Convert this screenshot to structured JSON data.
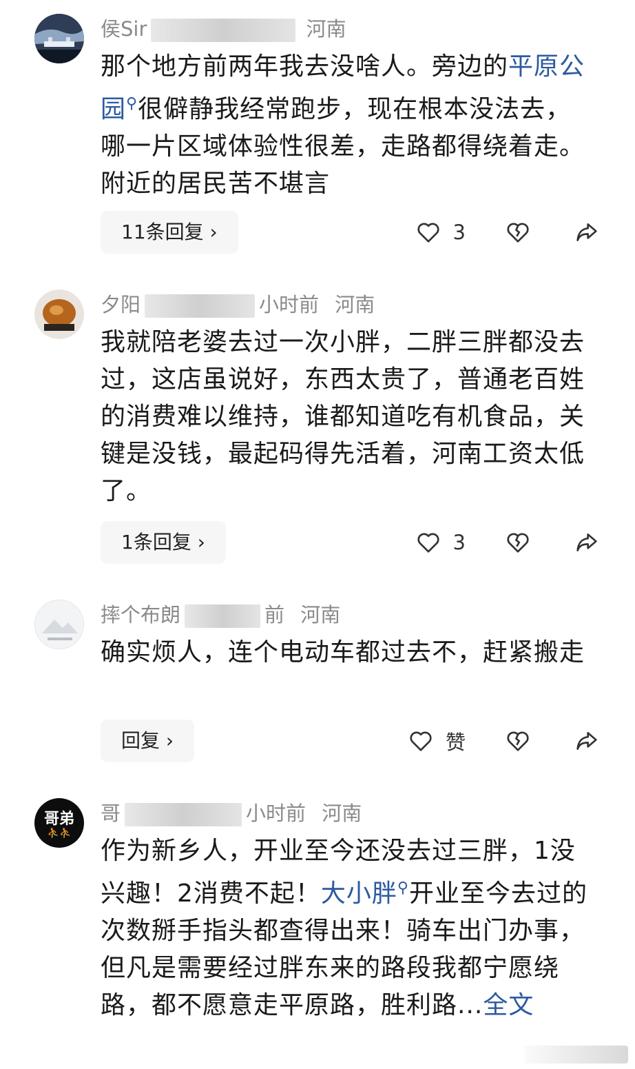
{
  "comments": [
    {
      "author": "侯Sir",
      "time": "",
      "region": "河南",
      "text_parts": [
        {
          "t": "那个地方前两年我去没啥人。旁边的",
          "link": false
        },
        {
          "t": "平原公园",
          "link": true
        },
        {
          "t": "很僻静我经常跑步，现在根本没法去，哪一片区域体验性很差，走路都得绕着走。附近的居民苦不堪言",
          "link": false
        }
      ],
      "reply_label": "11条回复",
      "likes": "3"
    },
    {
      "author": "夕阳",
      "time": "小时前",
      "region": "河南",
      "text_parts": [
        {
          "t": "我就陪老婆去过一次小胖，二胖三胖都没去过，这店虽说好，东西太贵了，普通老百姓的消费难以维持，谁都知道吃有机食品，关键是没钱，最起码得先活着，河南工资太低了。",
          "link": false
        }
      ],
      "reply_label": "1条回复",
      "likes": "3"
    },
    {
      "author": "摔个布朗",
      "time": "前",
      "region": "河南",
      "text_parts": [
        {
          "t": "确实烦人，连个电动车都过去不，赶紧搬走",
          "link": false
        }
      ],
      "reply_label": "回复",
      "likes": "赞"
    },
    {
      "author": "哥",
      "time": "小时前",
      "region": "河南",
      "text_parts": [
        {
          "t": "作为新乡人，开业至今还没去过三胖，1没兴趣！2消费不起！",
          "link": false
        },
        {
          "t": "大小胖",
          "link": true
        },
        {
          "t": "开业至今去过的次数掰手指头都查得出来！骑车出门办事，但凡是需要经过胖东来的路段我都宁愿绕路，都不愿意走平原路，胜利路...",
          "link": false
        },
        {
          "t": "全文",
          "link": true,
          "plain": true
        }
      ]
    }
  ],
  "icons": {
    "like": "heart-outline-icon",
    "dislike": "broken-heart-icon",
    "share": "share-arrow-icon",
    "search": "search-icon",
    "chevron": "chevron-right-icon"
  },
  "avatar4_text": "哥弟",
  "colors": {
    "link": "#2c5aa0",
    "meta": "#8a8a8a",
    "pill": "#f6f6f6"
  }
}
